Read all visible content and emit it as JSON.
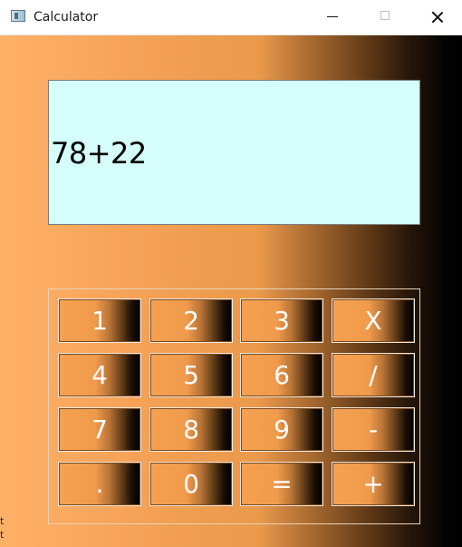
{
  "window": {
    "title": "Calculator",
    "controls": {
      "minimize": "minimize",
      "maximize": "maximize",
      "close": "close"
    }
  },
  "display": {
    "text": "78+22"
  },
  "keypad": {
    "rows": [
      [
        "1",
        "2",
        "3",
        "X"
      ],
      [
        "4",
        "5",
        "6",
        "/"
      ],
      [
        "7",
        "8",
        "9",
        "-"
      ],
      [
        ".",
        "0",
        "=",
        "+"
      ]
    ]
  },
  "edge_glyphs": [
    "t",
    "t"
  ],
  "colors": {
    "display_background": "#d5fdf9",
    "background_gradient_start": "#ffb168",
    "background_gradient_end": "#000000",
    "key_text": "#ffffff"
  },
  "icons": {
    "app": "calculator-window-icon"
  }
}
